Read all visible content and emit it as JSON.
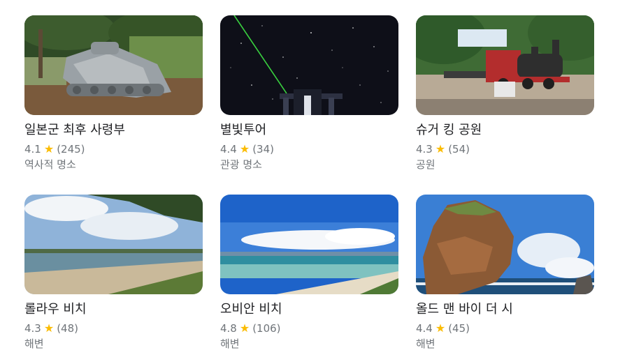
{
  "places": [
    {
      "name": "일본군 최후 사령부",
      "rating": "4.1",
      "reviews": "(245)",
      "category": "역사적 명소"
    },
    {
      "name": "별빛투어",
      "rating": "4.4",
      "reviews": "(34)",
      "category": "관광 명소"
    },
    {
      "name": "슈거 킹 공원",
      "rating": "4.3",
      "reviews": "(54)",
      "category": "공원"
    },
    {
      "name": "롤라우 비치",
      "rating": "4.3",
      "reviews": "(48)",
      "category": "해변"
    },
    {
      "name": "오비안 비치",
      "rating": "4.8",
      "reviews": "(106)",
      "category": "해변"
    },
    {
      "name": "올드 맨 바이 더 시",
      "rating": "4.4",
      "reviews": "(45)",
      "category": "해변"
    }
  ],
  "icons": {
    "rating": "star-icon"
  },
  "colors": {
    "star": "#fbbc04",
    "title": "#202124",
    "secondary": "#70757a"
  }
}
